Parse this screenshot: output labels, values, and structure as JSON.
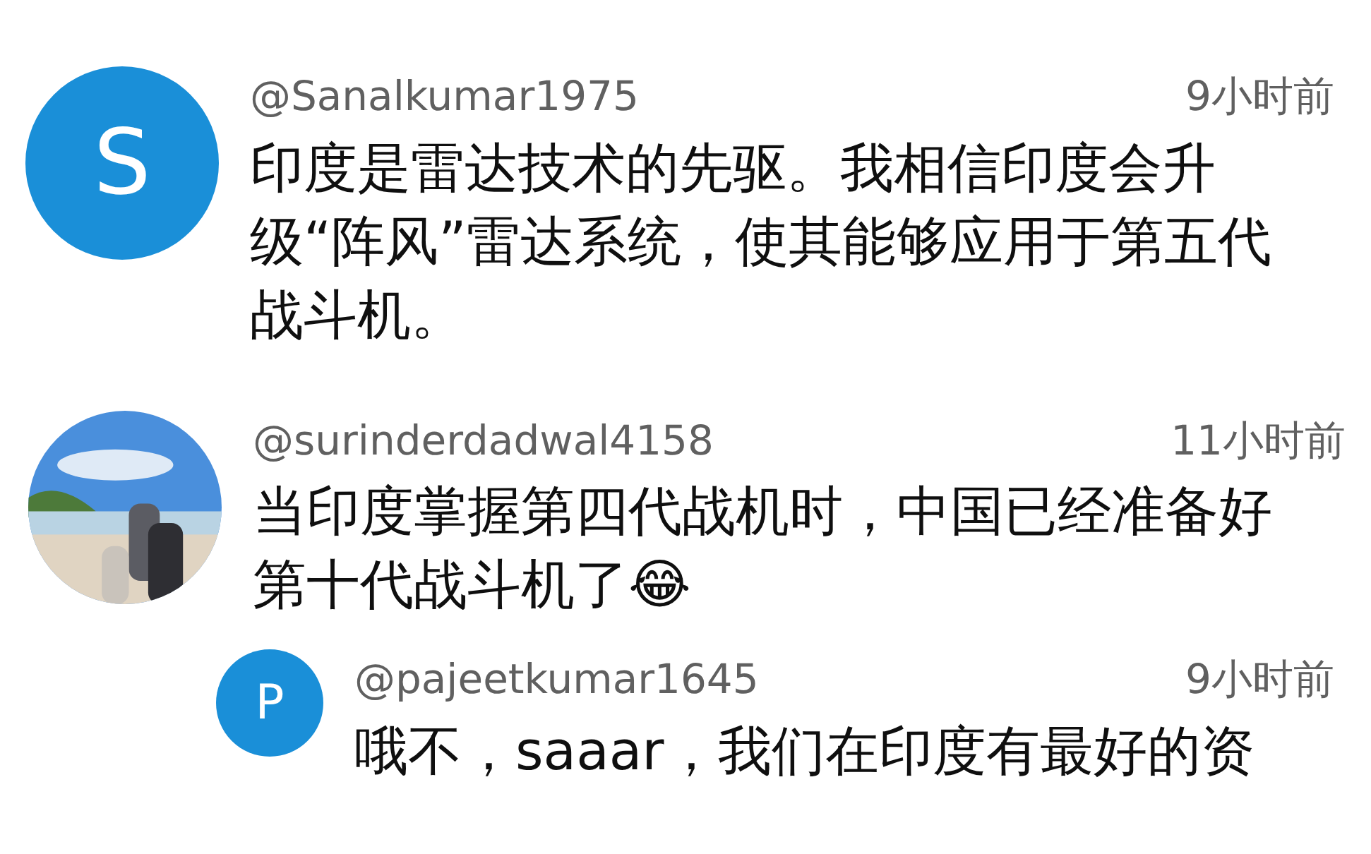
{
  "comments": [
    {
      "avatar": {
        "kind": "letter",
        "letter": "S",
        "color": "#1a8fd8"
      },
      "user": "@Sanalkumar1975",
      "time": "9小时前",
      "text": "印度是雷达技术的先驱。我相信印度会升级“阵风”雷达系统，使其能够应用于第五代战斗机。",
      "reply": false
    },
    {
      "user": "@surinderdadwal4158",
      "time": "11小时前",
      "text": "当印度掌握第四代战机时，中国已经准备好第十代战斗机了😂",
      "reply": false
    },
    {
      "avatar": {
        "kind": "letter",
        "letter": "P",
        "color": "#1a8fd8"
      },
      "user": "@pajeetkumar1645",
      "time": "9小时前",
      "text": "哦不，saaar，我们在印度有最好的资",
      "reply": true
    }
  ]
}
